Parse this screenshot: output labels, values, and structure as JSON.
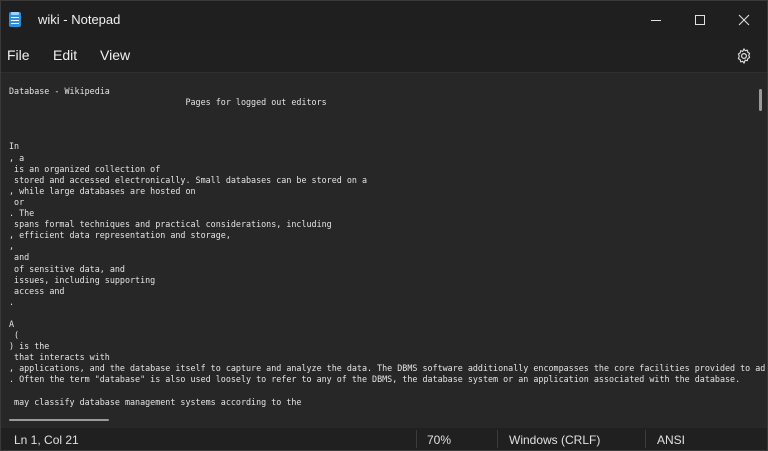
{
  "window": {
    "title": "wiki - Notepad",
    "icon": "notepad-icon",
    "controls": [
      "minimize-icon",
      "maximize-icon",
      "close-icon"
    ]
  },
  "menu": {
    "file": "File",
    "edit": "Edit",
    "view": "View",
    "settings_icon": "gear-icon"
  },
  "editor": {
    "lines": [
      "Database - Wikipedia",
      "                                   Pages for logged out editors",
      "",
      "",
      "",
      "In",
      ", a",
      " is an organized collection of",
      " stored and accessed electronically. Small databases can be stored on a",
      ", while large databases are hosted on",
      " or",
      ". The",
      " spans formal techniques and practical considerations, including",
      ", efficient data representation and storage,",
      ",",
      " and",
      " of sensitive data, and",
      " issues, including supporting",
      " access and",
      ".",
      "",
      "A",
      " (",
      ") is the",
      " that interacts with",
      ", applications, and the database itself to capture and analyze the data. The DBMS software additionally encompasses the core facilities provided to ad",
      ". Often the term \"database\" is also used loosely to refer to any of the DBMS, the database system or an application associated with the database.",
      "",
      " may classify database management systems according to the"
    ]
  },
  "status": {
    "position": "Ln 1, Col 21",
    "zoom": "70%",
    "line_ending": "Windows (CRLF)",
    "encoding": "ANSI"
  }
}
